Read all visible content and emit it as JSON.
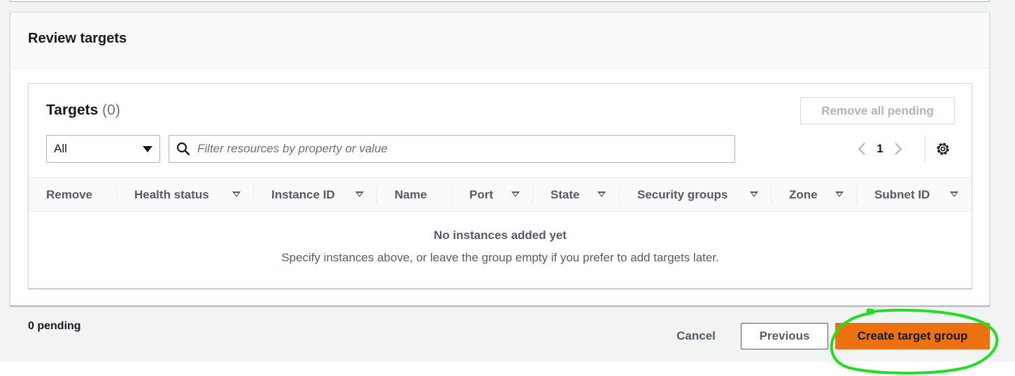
{
  "review": {
    "title": "Review targets"
  },
  "targets": {
    "title": "Targets",
    "count": "(0)",
    "remove_all_label": "Remove all pending",
    "filter_select_value": "All",
    "search_placeholder": "Filter resources by property or value",
    "current_page": "1",
    "columns": [
      {
        "label": "Remove",
        "sortable": false
      },
      {
        "label": "Health status",
        "sortable": true
      },
      {
        "label": "Instance ID",
        "sortable": true
      },
      {
        "label": "Name",
        "sortable": false
      },
      {
        "label": "Port",
        "sortable": true
      },
      {
        "label": "State",
        "sortable": true
      },
      {
        "label": "Security groups",
        "sortable": true
      },
      {
        "label": "Zone",
        "sortable": true
      },
      {
        "label": "Subnet ID",
        "sortable": true
      }
    ],
    "empty_title": "No instances added yet",
    "empty_description": "Specify instances above, or leave the group empty if you prefer to add targets later."
  },
  "footer": {
    "pending_text": "0 pending",
    "cancel_label": "Cancel",
    "previous_label": "Previous",
    "create_label": "Create target group"
  },
  "colors": {
    "primary_button": "#ec7211",
    "annotation_circle": "#1fe01f",
    "page_background": "#f2f3f3"
  },
  "icons": {
    "filter_dropdown": "caret-down-icon",
    "search": "search-icon",
    "prev_page": "chevron-left-icon",
    "next_page": "chevron-right-icon",
    "preferences": "gear-icon",
    "sort": "sort-caret-icon"
  }
}
